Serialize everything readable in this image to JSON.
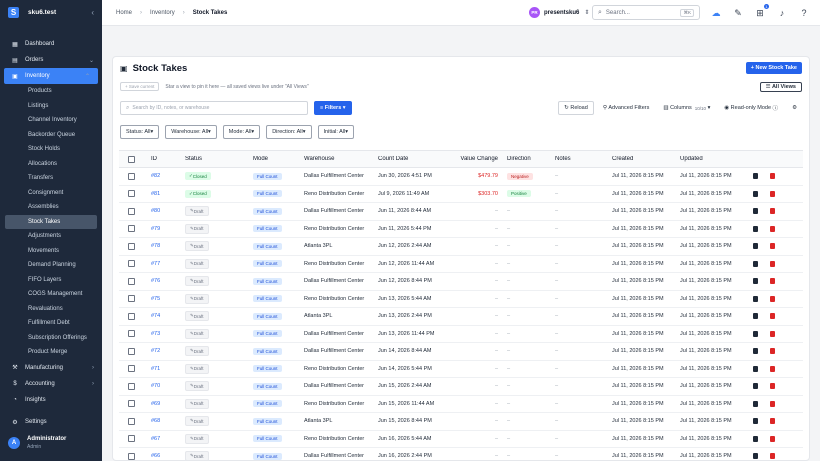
{
  "app": {
    "store_name": "sku6.test",
    "logo_letter": "S"
  },
  "nav": {
    "top": [
      {
        "label": "Dashboard",
        "icon": "dashboard-icon"
      },
      {
        "label": "Orders",
        "icon": "orders-icon",
        "chevron": "⌄"
      }
    ],
    "inventory": {
      "label": "Inventory",
      "icon": "inventory-icon",
      "chevron": "⌃"
    },
    "inventory_sub": [
      "Products",
      "Listings",
      "Channel Inventory",
      "Backorder Queue",
      "Stock Holds",
      "Allocations",
      "Transfers",
      "Consignment",
      "Assemblies",
      "Stock Takes",
      "Adjustments",
      "Movements",
      "Demand Planning",
      "FIFO Layers",
      "COGS Management",
      "Revaluations",
      "Fulfillment Debt",
      "Subscription Offerings",
      "Product Merge"
    ],
    "active_sub": "Stock Takes",
    "bottom": [
      {
        "label": "Manufacturing",
        "icon": "manufacturing-icon",
        "chevron": "›"
      },
      {
        "label": "Accounting",
        "icon": "accounting-icon",
        "chevron": "›"
      },
      {
        "label": "Insights",
        "icon": "insights-icon"
      }
    ],
    "settings": "Settings",
    "user": {
      "initial": "A",
      "name": "Administrator",
      "role": "Admin"
    }
  },
  "topbar": {
    "breadcrumb": [
      "Home",
      "Inventory",
      "Stock Takes"
    ],
    "store": {
      "badge": "PR",
      "name": "presentsku6"
    },
    "search_placeholder": "Search...",
    "search_kbd": "⌘K",
    "notif_count": "1"
  },
  "page": {
    "title": "Stock Takes",
    "new_button": "New Stock Take",
    "save_current": "Save current",
    "views_hint": "Star a view to pin it here — all saved views live under \"All Views\"",
    "all_views": "All Views",
    "filter_placeholder": "Search by ID, notes, or warehouse",
    "filters_button": "Filters",
    "reload": "Reload",
    "advanced_filters": "Advanced Filters",
    "columns": "Columns",
    "columns_count": "10/10",
    "readonly": "Read-only Mode",
    "chips": [
      "Status: All",
      "Warehouse: All",
      "Mode: All",
      "Direction: All",
      "Initial: All"
    ]
  },
  "table": {
    "headers": [
      "ID",
      "Status",
      "Mode",
      "Warehouse",
      "Count Date",
      "Value Change",
      "Direction",
      "Notes",
      "Created",
      "Updated"
    ],
    "rows": [
      {
        "id": "#82",
        "status": "Closed",
        "mode": "Full Count",
        "warehouse": "Dallas Fulfillment Center",
        "count_date": "Jun 30, 2026 4:51 PM",
        "value": "$479.79",
        "direction": "Negative",
        "notes": "–",
        "created": "Jul 11, 2026 8:15 PM",
        "updated": "Jul 11, 2026 8:15 PM"
      },
      {
        "id": "#81",
        "status": "Closed",
        "mode": "Full Count",
        "warehouse": "Reno Distribution Center",
        "count_date": "Jul 9, 2026 11:49 AM",
        "value": "$303.70",
        "direction": "Positive",
        "notes": "–",
        "created": "Jul 11, 2026 8:15 PM",
        "updated": "Jul 11, 2026 8:15 PM"
      },
      {
        "id": "#80",
        "status": "Draft",
        "mode": "Full Count",
        "warehouse": "Dallas Fulfillment Center",
        "count_date": "Jun 11, 2026 8:44 AM",
        "value": "–",
        "direction": "–",
        "notes": "–",
        "created": "Jul 11, 2026 8:15 PM",
        "updated": "Jul 11, 2026 8:15 PM"
      },
      {
        "id": "#79",
        "status": "Draft",
        "mode": "Full Count",
        "warehouse": "Reno Distribution Center",
        "count_date": "Jun 11, 2026 5:44 PM",
        "value": "–",
        "direction": "–",
        "notes": "–",
        "created": "Jul 11, 2026 8:15 PM",
        "updated": "Jul 11, 2026 8:15 PM"
      },
      {
        "id": "#78",
        "status": "Draft",
        "mode": "Full Count",
        "warehouse": "Atlanta 3PL",
        "count_date": "Jun 12, 2026 2:44 AM",
        "value": "–",
        "direction": "–",
        "notes": "–",
        "created": "Jul 11, 2026 8:15 PM",
        "updated": "Jul 11, 2026 8:15 PM"
      },
      {
        "id": "#77",
        "status": "Draft",
        "mode": "Full Count",
        "warehouse": "Reno Distribution Center",
        "count_date": "Jun 12, 2026 11:44 AM",
        "value": "–",
        "direction": "–",
        "notes": "–",
        "created": "Jul 11, 2026 8:15 PM",
        "updated": "Jul 11, 2026 8:15 PM"
      },
      {
        "id": "#76",
        "status": "Draft",
        "mode": "Full Count",
        "warehouse": "Dallas Fulfillment Center",
        "count_date": "Jun 12, 2026 8:44 PM",
        "value": "–",
        "direction": "–",
        "notes": "–",
        "created": "Jul 11, 2026 8:15 PM",
        "updated": "Jul 11, 2026 8:15 PM"
      },
      {
        "id": "#75",
        "status": "Draft",
        "mode": "Full Count",
        "warehouse": "Reno Distribution Center",
        "count_date": "Jun 13, 2026 5:44 AM",
        "value": "–",
        "direction": "–",
        "notes": "–",
        "created": "Jul 11, 2026 8:15 PM",
        "updated": "Jul 11, 2026 8:15 PM"
      },
      {
        "id": "#74",
        "status": "Draft",
        "mode": "Full Count",
        "warehouse": "Atlanta 3PL",
        "count_date": "Jun 13, 2026 2:44 PM",
        "value": "–",
        "direction": "–",
        "notes": "–",
        "created": "Jul 11, 2026 8:15 PM",
        "updated": "Jul 11, 2026 8:15 PM"
      },
      {
        "id": "#73",
        "status": "Draft",
        "mode": "Full Count",
        "warehouse": "Dallas Fulfillment Center",
        "count_date": "Jun 13, 2026 11:44 PM",
        "value": "–",
        "direction": "–",
        "notes": "–",
        "created": "Jul 11, 2026 8:15 PM",
        "updated": "Jul 11, 2026 8:15 PM"
      },
      {
        "id": "#72",
        "status": "Draft",
        "mode": "Full Count",
        "warehouse": "Dallas Fulfillment Center",
        "count_date": "Jun 14, 2026 8:44 AM",
        "value": "–",
        "direction": "–",
        "notes": "–",
        "created": "Jul 11, 2026 8:15 PM",
        "updated": "Jul 11, 2026 8:15 PM"
      },
      {
        "id": "#71",
        "status": "Draft",
        "mode": "Full Count",
        "warehouse": "Reno Distribution Center",
        "count_date": "Jun 14, 2026 5:44 PM",
        "value": "–",
        "direction": "–",
        "notes": "–",
        "created": "Jul 11, 2026 8:15 PM",
        "updated": "Jul 11, 2026 8:15 PM"
      },
      {
        "id": "#70",
        "status": "Draft",
        "mode": "Full Count",
        "warehouse": "Dallas Fulfillment Center",
        "count_date": "Jun 15, 2026 2:44 AM",
        "value": "–",
        "direction": "–",
        "notes": "–",
        "created": "Jul 11, 2026 8:15 PM",
        "updated": "Jul 11, 2026 8:15 PM"
      },
      {
        "id": "#69",
        "status": "Draft",
        "mode": "Full Count",
        "warehouse": "Reno Distribution Center",
        "count_date": "Jun 15, 2026 11:44 AM",
        "value": "–",
        "direction": "–",
        "notes": "–",
        "created": "Jul 11, 2026 8:15 PM",
        "updated": "Jul 11, 2026 8:15 PM"
      },
      {
        "id": "#68",
        "status": "Draft",
        "mode": "Full Count",
        "warehouse": "Atlanta 3PL",
        "count_date": "Jun 15, 2026 8:44 PM",
        "value": "–",
        "direction": "–",
        "notes": "–",
        "created": "Jul 11, 2026 8:15 PM",
        "updated": "Jul 11, 2026 8:15 PM"
      },
      {
        "id": "#67",
        "status": "Draft",
        "mode": "Full Count",
        "warehouse": "Reno Distribution Center",
        "count_date": "Jun 16, 2026 5:44 AM",
        "value": "–",
        "direction": "–",
        "notes": "–",
        "created": "Jul 11, 2026 8:15 PM",
        "updated": "Jul 11, 2026 8:15 PM"
      },
      {
        "id": "#66",
        "status": "Draft",
        "mode": "Full Count",
        "warehouse": "Dallas Fulfillment Center",
        "count_date": "Jun 16, 2026 2:44 PM",
        "value": "–",
        "direction": "–",
        "notes": "–",
        "created": "Jul 11, 2026 8:15 PM",
        "updated": "Jul 11, 2026 8:15 PM"
      }
    ]
  },
  "colors": {
    "sidebar_bg": "#1e293b",
    "accent": "#2563eb",
    "closed": "#15803d",
    "negative": "#dc2626"
  }
}
